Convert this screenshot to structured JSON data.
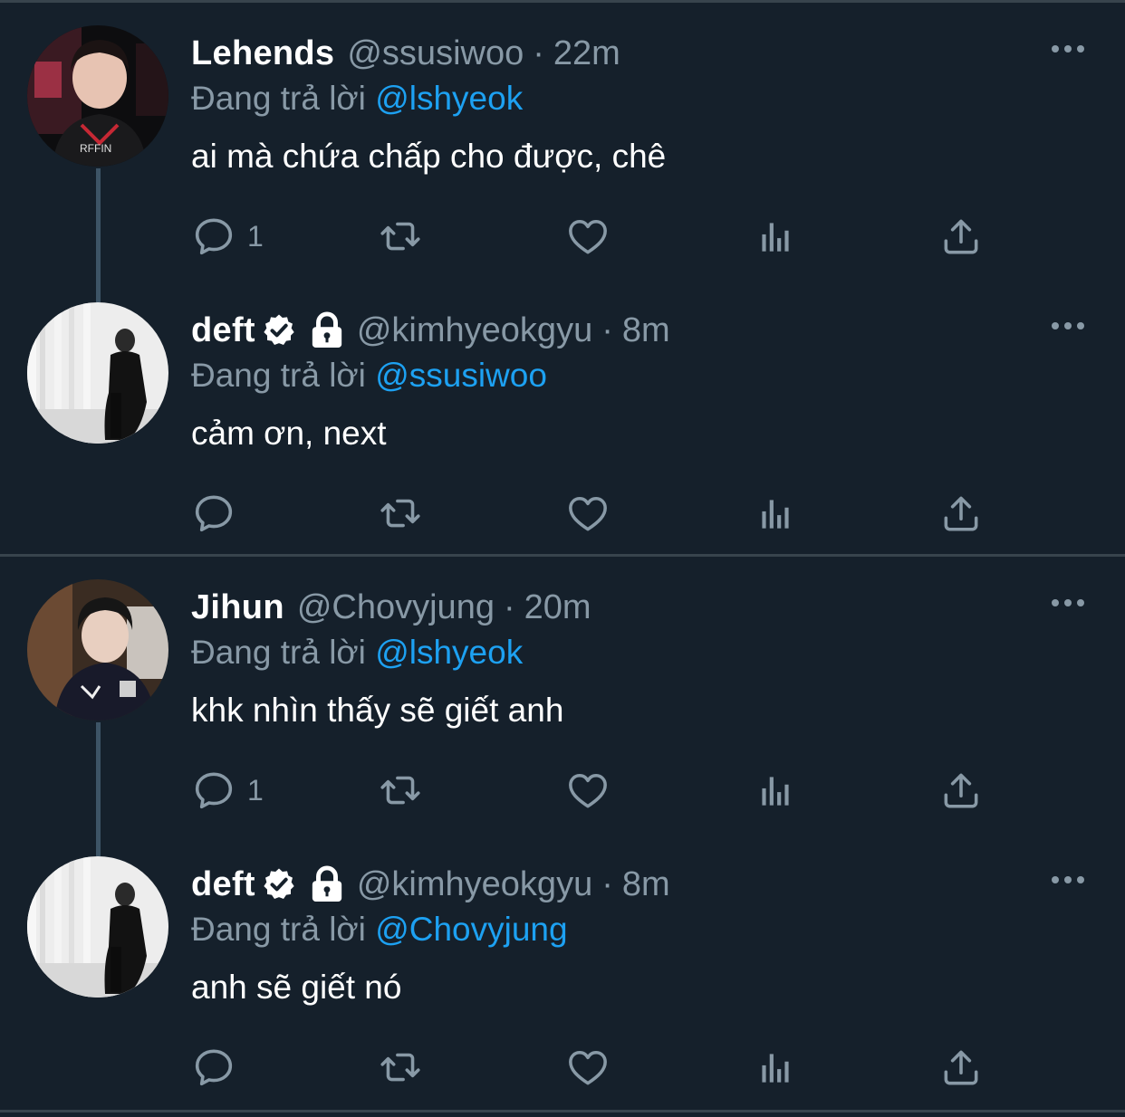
{
  "reply_prefix": "Đang trả lời",
  "tweets": [
    {
      "name": "Lehends",
      "verified": false,
      "protected": false,
      "handle": "@ssusiwoo",
      "separator": "·",
      "time": "22m",
      "reply_to": "@lshyeok",
      "text": "ai mà chứa chấp cho được, chê",
      "reply_count": "1",
      "avatar": "avatar-lehends"
    },
    {
      "name": "deft",
      "verified": true,
      "protected": true,
      "handle": "@kimhyeokgyu",
      "separator": "·",
      "time": "8m",
      "reply_to": "@ssusiwoo",
      "text": "cảm ơn, next",
      "reply_count": "",
      "avatar": "avatar-deft"
    },
    {
      "name": "Jihun",
      "verified": false,
      "protected": false,
      "handle": "@Chovyjung",
      "separator": "·",
      "time": "20m",
      "reply_to": "@lshyeok",
      "text": "khk nhìn thấy sẽ giết anh",
      "reply_count": "1",
      "avatar": "avatar-jihun"
    },
    {
      "name": "deft",
      "verified": true,
      "protected": true,
      "handle": "@kimhyeokgyu",
      "separator": "·",
      "time": "8m",
      "reply_to": "@Chovyjung",
      "text": "anh sẽ giết nó",
      "reply_count": "",
      "avatar": "avatar-deft"
    }
  ],
  "icons": {
    "reply": "reply-icon",
    "retweet": "retweet-icon",
    "like": "heart-icon",
    "analytics": "analytics-icon",
    "share": "share-icon",
    "more": "more-icon",
    "verified": "verified-badge-icon",
    "protected": "lock-icon"
  },
  "colors": {
    "background": "#15202b",
    "muted": "#8899a6",
    "link": "#1da1f2",
    "divider": "#38444d",
    "thread_line": "#3d5466"
  }
}
